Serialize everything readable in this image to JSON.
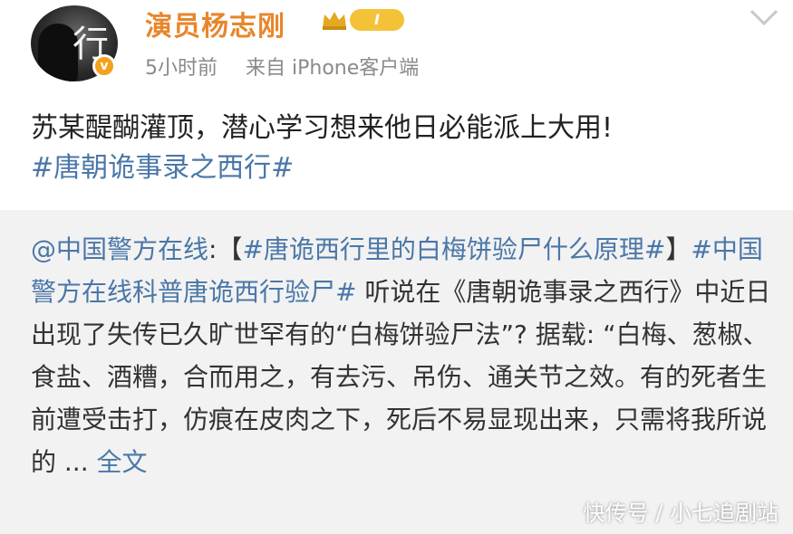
{
  "post": {
    "author": {
      "name": "演员杨志刚",
      "level": "I",
      "verified_badge": "v"
    },
    "meta": {
      "time": "5小时前",
      "source": "来自 iPhone客户端"
    },
    "content": {
      "text": "苏某醍醐灌顶，潜心学习想来他日必能派上大用!",
      "hashtag": "#唐朝诡事录之西行#"
    }
  },
  "repost": {
    "author_link": "@中国警方在线",
    "colon": ":",
    "bracket_open": "【",
    "bracket_tag": "#唐诡西行里的白梅饼验尸什么原理#",
    "bracket_close": "】",
    "tag2": "#中国警方在线科普唐诡西行验尸#",
    "body": " 听说在《唐朝诡事录之西行》中近日出现了失传已久旷世罕有的“白梅饼验尸法”? 据载: “白梅、葱椒、食盐、酒糟，合而用之，有去污、吊伤、通关节之效。有的死者生前遭受击打，仿痕在皮肉之下，死后不易显现出来，只需将我所说的 ... ",
    "more_link": "全文"
  },
  "watermark": "快传号 / 小七追剧站",
  "colors": {
    "username": "#e8862b",
    "link": "#4a77a8",
    "repost_bg": "#f2f2f2",
    "meta": "#8a8a8a"
  },
  "icons": {
    "avatar": "avatar",
    "verified": "verified-badge-icon",
    "crown": "crown-icon",
    "chevron": "chevron-down-icon"
  }
}
